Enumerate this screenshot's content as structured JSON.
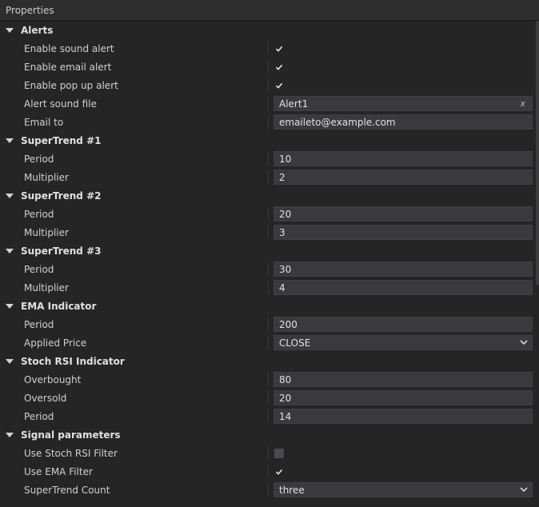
{
  "panel": {
    "title": "Properties"
  },
  "sections": [
    {
      "title": "Alerts",
      "props": [
        {
          "label": "Enable sound alert",
          "type": "check",
          "checked": true
        },
        {
          "label": "Enable email alert",
          "type": "check",
          "checked": true
        },
        {
          "label": "Enable pop up alert",
          "type": "check",
          "checked": true
        },
        {
          "label": "Alert sound file",
          "type": "text-clear",
          "value": "Alert1",
          "clear": "x"
        },
        {
          "label": "Email to",
          "type": "text",
          "value": "emaileto@example.com"
        }
      ]
    },
    {
      "title": "SuperTrend #1",
      "props": [
        {
          "label": "Period",
          "type": "text",
          "value": "10"
        },
        {
          "label": "Multiplier",
          "type": "text",
          "value": "2"
        }
      ]
    },
    {
      "title": "SuperTrend #2",
      "props": [
        {
          "label": "Period",
          "type": "text",
          "value": "20"
        },
        {
          "label": "Multiplier",
          "type": "text",
          "value": "3"
        }
      ]
    },
    {
      "title": "SuperTrend #3",
      "props": [
        {
          "label": "Period",
          "type": "text",
          "value": "30"
        },
        {
          "label": "Multiplier",
          "type": "text",
          "value": "4"
        }
      ]
    },
    {
      "title": "EMA Indicator",
      "props": [
        {
          "label": "Period",
          "type": "text",
          "value": "200"
        },
        {
          "label": "Applied Price",
          "type": "select",
          "value": "CLOSE"
        }
      ]
    },
    {
      "title": "Stoch RSI Indicator",
      "props": [
        {
          "label": "Overbought",
          "type": "text",
          "value": "80"
        },
        {
          "label": "Oversold",
          "type": "text",
          "value": "20"
        },
        {
          "label": "Period",
          "type": "text",
          "value": "14"
        }
      ]
    },
    {
      "title": "Signal parameters",
      "props": [
        {
          "label": "Use Stoch RSI Filter",
          "type": "check",
          "checked": false
        },
        {
          "label": "Use EMA Filter",
          "type": "check",
          "checked": true
        },
        {
          "label": "SuperTrend Count",
          "type": "select",
          "value": "three"
        }
      ]
    }
  ]
}
